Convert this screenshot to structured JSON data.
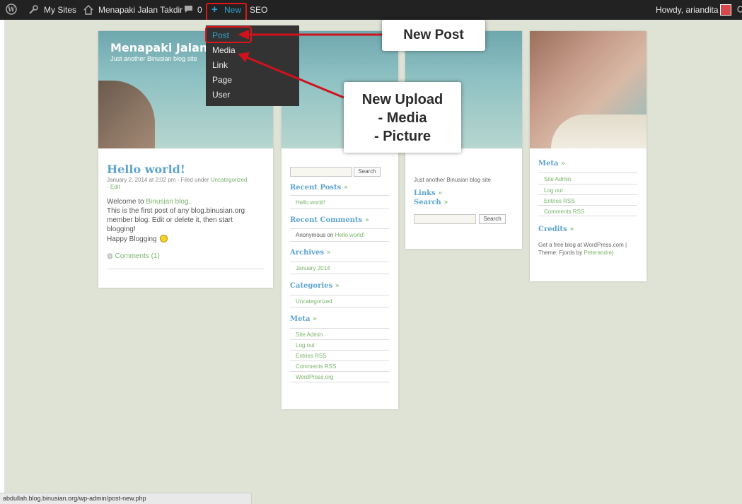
{
  "admin_bar": {
    "my_sites": "My Sites",
    "site_name": "Menapaki Jalan Takdir",
    "comments_count": "0",
    "new_label": "New",
    "seo_label": "SEO",
    "howdy": "Howdy, ariandita"
  },
  "new_menu": {
    "items": [
      "Post",
      "Media",
      "Link",
      "Page",
      "User"
    ]
  },
  "callouts": {
    "new_post": "New Post",
    "new_upload": [
      "New Upload",
      "- Media",
      "- Picture"
    ]
  },
  "blog": {
    "title": "Menapaki Jalan Tak",
    "tagline": "Just another Binusian blog site",
    "post": {
      "title": "Hello world!",
      "meta_prefix": "January 2, 2014 at 2:02 pm - Filed under ",
      "meta_category": "Uncategorized",
      "meta_edit": "- Edit",
      "welcome_prefix": "Welcome to ",
      "welcome_link": "Binusian blog",
      "lines": [
        "This is the first post of any blog.binusian.org",
        "member blog. Edit or delete it, then start",
        "blogging!"
      ],
      "happy": "Happy Blogging",
      "comments": "Comments (1)"
    },
    "col2": {
      "search_button": "Search",
      "recent_posts_title": "Recent Posts",
      "recent_posts": [
        "Hello world!"
      ],
      "recent_comments_title": "Recent Comments",
      "recent_comment_author": "Anonymous on ",
      "recent_comment_link": "Hello world!",
      "archives_title": "Archives",
      "archives": [
        "January 2014"
      ],
      "categories_title": "Categories",
      "categories": [
        "Uncategorized"
      ],
      "meta_title": "Meta",
      "meta": [
        "Site Admin",
        "Log out",
        "Entries RSS",
        "Comments RSS",
        "WordPress.org"
      ]
    },
    "col3": {
      "tagline": "Just another Binusian blog site",
      "links_title": "Links",
      "search_title": "Search",
      "search_button": "Search"
    },
    "col4": {
      "meta_title": "Meta",
      "meta": [
        "Site Admin",
        "Log out",
        "Entries RSS",
        "Comments RSS"
      ],
      "credits_title": "Credits",
      "credits_line1": "Get a free blog at WordPress.com |",
      "credits_theme_prefix": "Theme: Fjords by ",
      "credits_theme_link": "Peterandrej"
    }
  },
  "raquo": "»",
  "status_url": "abdullah.blog.binusian.org/wp-admin/post-new.php",
  "colors": {
    "admin_bar": "#222222",
    "accent_blue": "#2ea2cc",
    "highlight_red": "#e0141b",
    "link_green": "#7ab46d",
    "page_bg": "#dfe3d6"
  }
}
